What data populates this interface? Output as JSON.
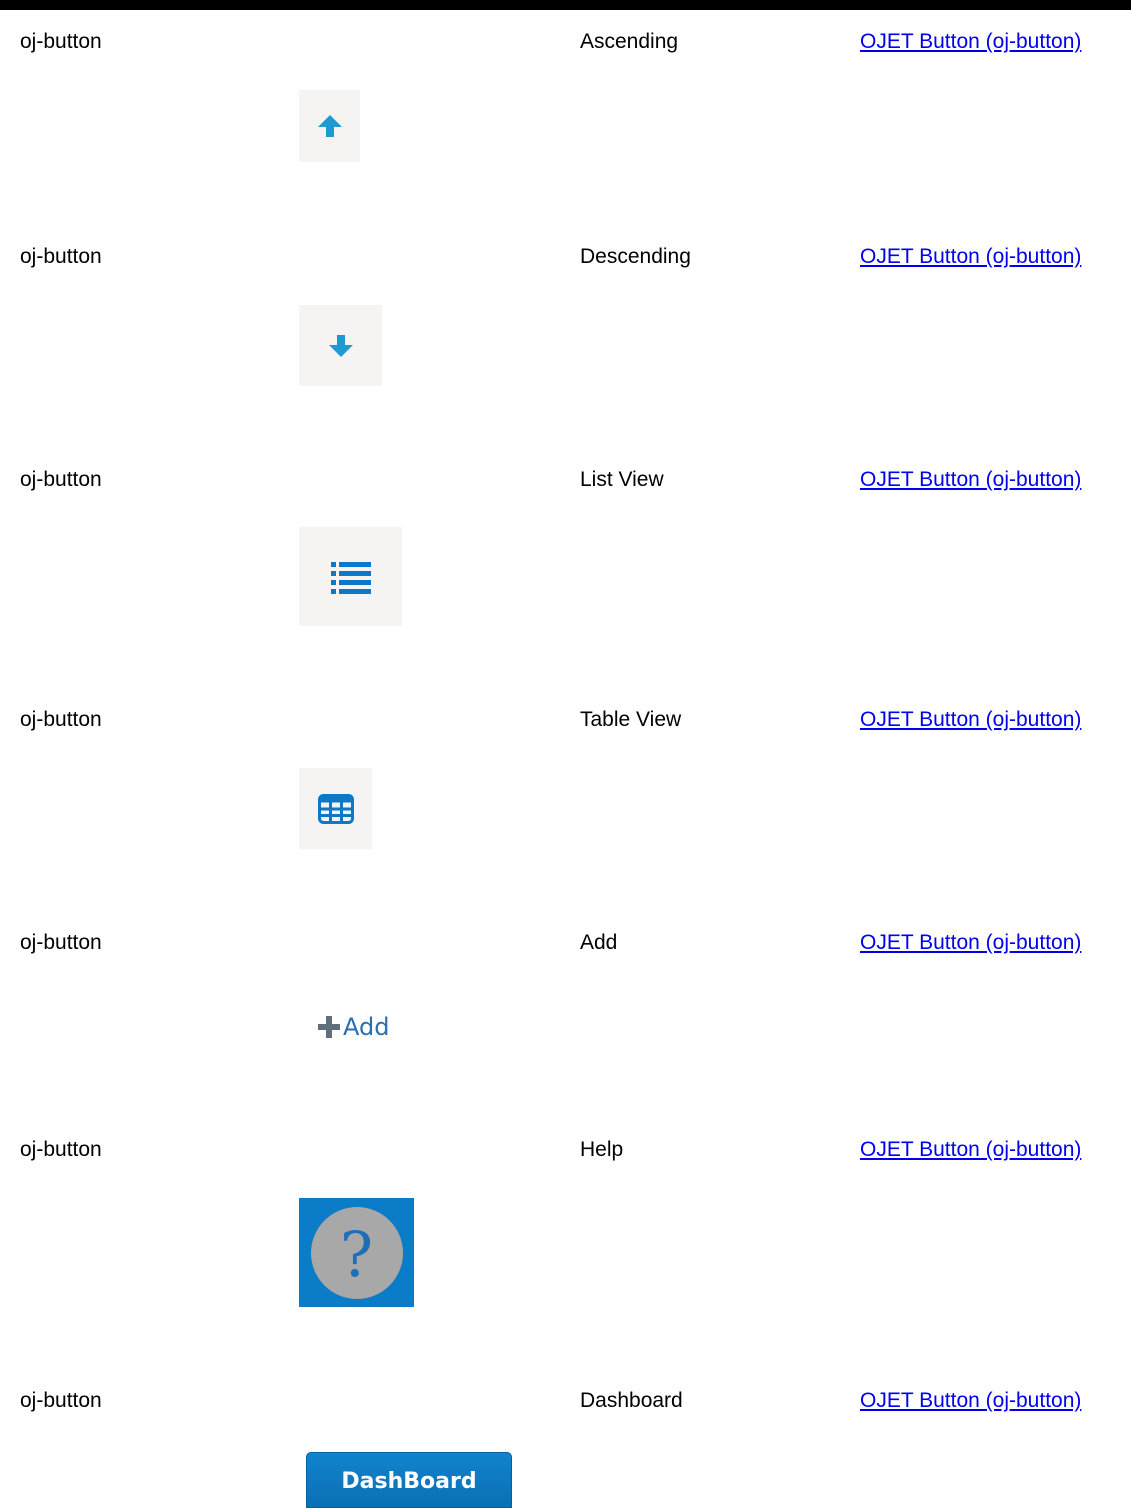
{
  "rows": [
    {
      "component": "oj-button",
      "label": "Ascending",
      "reference": "OJET Button (oj-button)",
      "icon": "arrow-up-icon",
      "color": "#1d9bd1"
    },
    {
      "component": "oj-button",
      "label": "Descending",
      "reference": "OJET Button (oj-button)",
      "icon": "arrow-down-icon",
      "color": "#1d9bd1"
    },
    {
      "component": "oj-button",
      "label": "List View",
      "reference": "OJET Button (oj-button)",
      "icon": "list-view-icon",
      "color": "#0b79c7"
    },
    {
      "component": "oj-button",
      "label": "Table View",
      "reference": "OJET Button (oj-button)",
      "icon": "table-grid-icon",
      "color": "#0b79c7"
    },
    {
      "component": "oj-button",
      "label": "Add",
      "reference": "OJET Button (oj-button)",
      "icon": "plus-icon",
      "button_text": "Add",
      "color": "#2a6fb0"
    },
    {
      "component": "oj-button",
      "label": "Help",
      "reference": "OJET Button (oj-button)",
      "icon": "help-question-icon",
      "button_text": "?",
      "color": "#0a7cc8"
    },
    {
      "component": "oj-button",
      "label": "Dashboard",
      "reference": "OJET Button (oj-button)",
      "button_text": "DashBoard",
      "color": "#0a75bf"
    }
  ]
}
